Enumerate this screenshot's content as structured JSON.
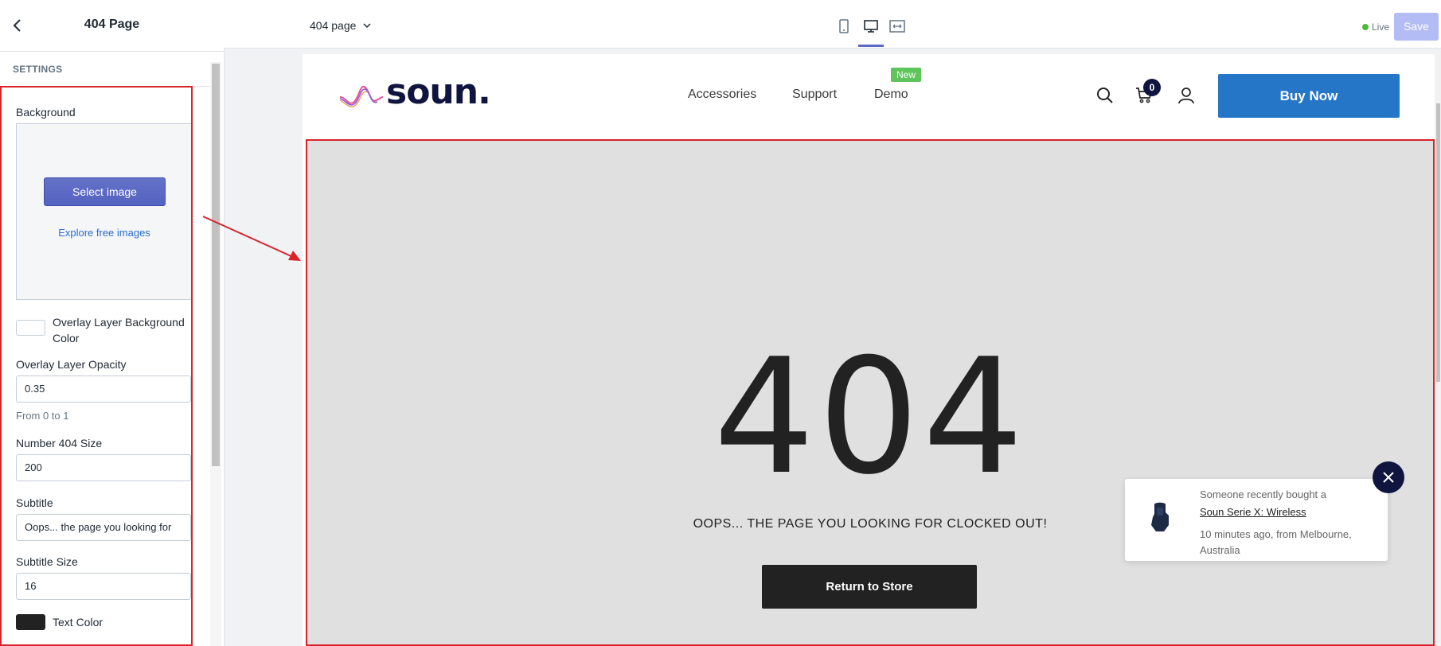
{
  "sidebar": {
    "title": "404 Page",
    "section_heading": "SETTINGS",
    "background_label": "Background",
    "select_image_label": "Select image",
    "explore_images_label": "Explore free images",
    "overlay_color_label": "Overlay Layer Background Color",
    "overlay_color": "#ffffff",
    "overlay_opacity_label": "Overlay Layer Opacity",
    "overlay_opacity_value": "0.35",
    "overlay_opacity_help": "From 0 to 1",
    "number_size_label": "Number 404 Size",
    "number_size_value": "200",
    "subtitle_label": "Subtitle",
    "subtitle_value": "Oops... the page you looking for",
    "subtitle_size_label": "Subtitle Size",
    "subtitle_size_value": "16",
    "text_color_label": "Text Color",
    "text_color": "#222222"
  },
  "topbar": {
    "page_select": "404 page",
    "status_label": "Live",
    "save_label": "Save"
  },
  "store": {
    "logo_text": "soun.",
    "nav": [
      {
        "label": "Accessories"
      },
      {
        "label": "Support"
      },
      {
        "label": "Demo"
      }
    ],
    "new_badge": "New",
    "cart_count": "0",
    "buy_now_label": "Buy Now",
    "error_number": "404",
    "subtitle": "OOPS... THE PAGE YOU LOOKING FOR CLOCKED OUT!",
    "return_label": "Return to Store",
    "popup": {
      "line1": "Someone recently bought a",
      "product": "Soun Serie X: Wireless",
      "line3": "10 minutes ago, from Melbourne, Australia"
    }
  },
  "colors": {
    "accent": "#5c6ac4",
    "buy_now": "#2676c8",
    "brand_navy": "#10153f",
    "highlight": "#d8232a",
    "new_badge": "#5ec45b"
  }
}
